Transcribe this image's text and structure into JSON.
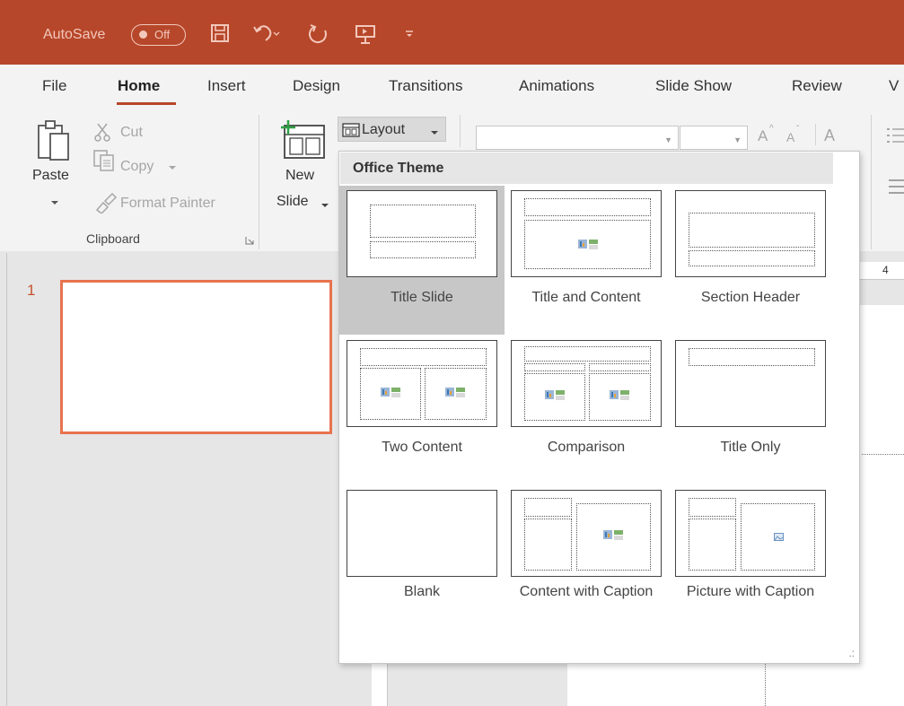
{
  "titlebar": {
    "autosave_label": "AutoSave",
    "autosave_state": "Off",
    "colors": {
      "background": "#b7472a",
      "foreground": "#f2c8bc"
    },
    "icons": [
      "save-icon",
      "undo-icon",
      "redo-icon",
      "presentation-icon",
      "customize-qat-icon"
    ]
  },
  "tabs": {
    "items": [
      "File",
      "Home",
      "Insert",
      "Design",
      "Transitions",
      "Animations",
      "Slide Show",
      "Review",
      "V"
    ],
    "active": "Home"
  },
  "ribbon": {
    "clipboard": {
      "paste_label": "Paste",
      "cut_label": "Cut",
      "copy_label": "Copy",
      "format_painter_label": "Format Painter",
      "group_label": "Clipboard"
    },
    "slides": {
      "new_slide_line1": "New",
      "new_slide_line2": "Slide",
      "layout_label": "Layout"
    },
    "font": {
      "grow_label": "A",
      "shrink_label": "A",
      "clear_label": "A"
    }
  },
  "workspace": {
    "slide_number": "1",
    "ruler_mark": "4"
  },
  "layout_menu": {
    "header": "Office Theme",
    "items": [
      {
        "label": "Title Slide",
        "selected": true
      },
      {
        "label": "Title and Content",
        "selected": false
      },
      {
        "label": "Section Header",
        "selected": false
      },
      {
        "label": "Two Content",
        "selected": false
      },
      {
        "label": "Comparison",
        "selected": false
      },
      {
        "label": "Title Only",
        "selected": false
      },
      {
        "label": "Blank",
        "selected": false
      },
      {
        "label": "Content with Caption",
        "selected": false
      },
      {
        "label": "Picture with Caption",
        "selected": false
      }
    ]
  }
}
